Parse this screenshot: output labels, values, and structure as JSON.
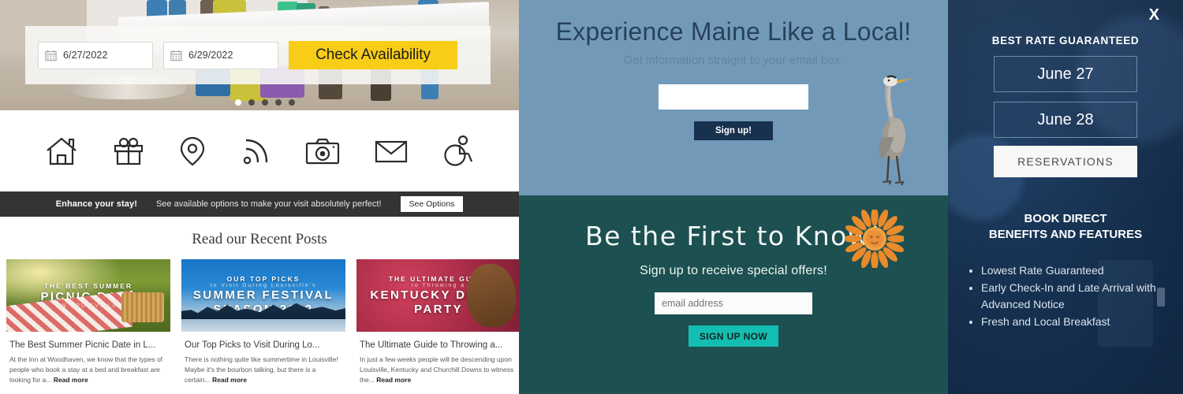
{
  "left_panel": {
    "booking": {
      "checkin_value": "6/27/2022",
      "checkout_value": "6/29/2022",
      "check_button": "Check Availability",
      "carousel_dots": 5,
      "active_dot": 1
    },
    "icons": [
      "home-icon",
      "gift-icon",
      "map-pin-icon",
      "rss-icon",
      "camera-icon",
      "envelope-icon",
      "accessibility-icon"
    ],
    "enhance_bar": {
      "title": "Enhance your stay!",
      "text": "See available options to make your visit absolutely perfect!",
      "button": "See Options"
    },
    "posts_heading": "Read our Recent Posts",
    "posts": [
      {
        "overline": "THE BEST SUMMER",
        "headline": "PICNIC DATE",
        "subline": "IN LOUISVILLE",
        "title": "The Best Summer Picnic Date in L...",
        "excerpt": "At the Inn at Woodhaven, we know that the types of people who book a stay at a bed and breakfast are looking for a...",
        "read_more": "Read more"
      },
      {
        "overline": "OUR TOP PICKS",
        "headline": "SUMMER FESTIVAL SEASON 2022",
        "subline": "to Visit During Louisville's",
        "title": "Our Top Picks to Visit During Lo...",
        "excerpt": "There is nothing quite like summertime in Louisville! Maybe it's the bourbon talking, but there is a certain...",
        "read_more": "Read more"
      },
      {
        "overline": "THE ULTIMATE GUIDE",
        "headline": "KENTUCKY DERBY PARTY",
        "subline": "to Throwing a",
        "title": "The Ultimate Guide to Throwing a...",
        "excerpt": "In just a few weeks people will be descending upon Louisville, Kentucky and Churchill Downs to witness the...",
        "read_more": "Read more"
      }
    ]
  },
  "mid_panel": {
    "maine": {
      "heading": "Experience Maine Like a Local!",
      "subheading": "Get information straight to your email box.",
      "input_value": "",
      "input_placeholder": "",
      "button": "Sign up!",
      "bg_color": "#729ab8",
      "button_color": "#17314f",
      "image": "heron-illustration"
    },
    "know": {
      "heading": "Be the First to Know!",
      "subheading": "Sign up to receive special offers!",
      "input_placeholder": "email address",
      "button": "SIGN UP NOW",
      "bg_color": "#1d5050",
      "button_color": "#14bdb2",
      "image": "sunflower-illustration"
    }
  },
  "right_panel": {
    "close_label": "X",
    "best_rate": "BEST RATE GUARANTEED",
    "date_in": "June 27",
    "date_out": "June 28",
    "reservations_button": "RESERVATIONS",
    "book_direct_line1": "BOOK DIRECT",
    "book_direct_line2": "BENEFITS AND FEATURES",
    "benefits": [
      "Lowest Rate Guaranteed",
      "Early Check-In and Late Arrival with Advanced Notice",
      "Fresh and Local Breakfast"
    ],
    "bg_color": "#16304f"
  }
}
